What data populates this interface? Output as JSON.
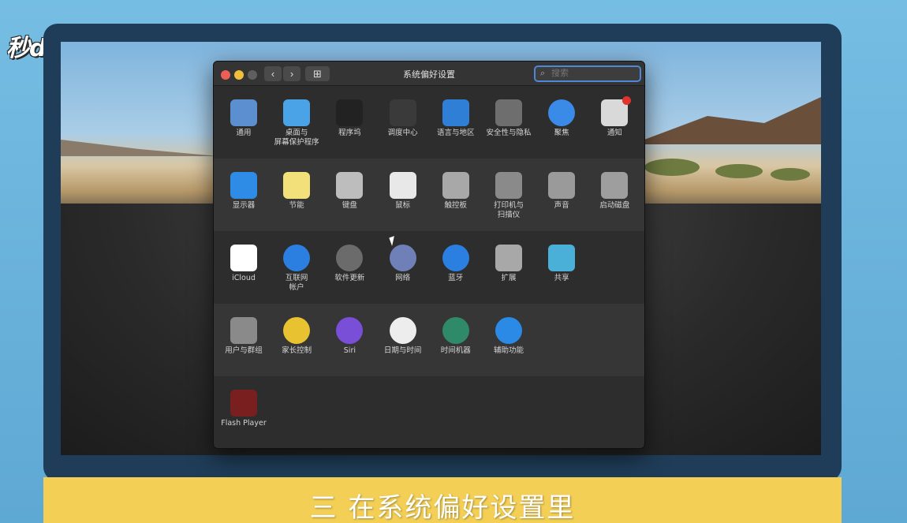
{
  "overlay": {
    "logo": "秒dong视频",
    "caption": "三 在系统偏好设置里"
  },
  "window": {
    "title": "系统偏好设置",
    "search_placeholder": "搜索",
    "nav_back": "‹",
    "nav_forward": "›",
    "grid_icon": "⊞"
  },
  "rows": [
    [
      {
        "label": "通用",
        "icon": "general-icon",
        "color": "#5b8fcf"
      },
      {
        "label": "桌面与\n屏幕保护程序",
        "icon": "desktop-screensaver-icon",
        "color": "#4aa3e6"
      },
      {
        "label": "程序坞",
        "icon": "dock-icon",
        "color": "#222222"
      },
      {
        "label": "调度中心",
        "icon": "mission-control-icon",
        "color": "#3a3a3a"
      },
      {
        "label": "语言与地区",
        "icon": "language-region-icon",
        "color": "#2f7fd6"
      },
      {
        "label": "安全性与隐私",
        "icon": "security-privacy-icon",
        "color": "#6e6e6e"
      },
      {
        "label": "聚焦",
        "icon": "spotlight-icon",
        "color": "#3a8be8"
      },
      {
        "label": "通知",
        "icon": "notifications-icon",
        "color": "#d9d9d9"
      }
    ],
    [
      {
        "label": "显示器",
        "icon": "displays-icon",
        "color": "#2e8be6"
      },
      {
        "label": "节能",
        "icon": "energy-saver-icon",
        "color": "#f2e07a"
      },
      {
        "label": "键盘",
        "icon": "keyboard-icon",
        "color": "#bdbdbd"
      },
      {
        "label": "鼠标",
        "icon": "mouse-icon",
        "color": "#e8e8e8"
      },
      {
        "label": "触控板",
        "icon": "trackpad-icon",
        "color": "#a8a8a8"
      },
      {
        "label": "打印机与\n扫描仪",
        "icon": "printer-icon",
        "color": "#8a8a8a"
      },
      {
        "label": "声音",
        "icon": "sound-icon",
        "color": "#9a9a9a"
      },
      {
        "label": "启动磁盘",
        "icon": "startup-disk-icon",
        "color": "#9e9e9e"
      }
    ],
    [
      {
        "label": "iCloud",
        "icon": "icloud-icon",
        "color": "#ffffff"
      },
      {
        "label": "互联网\n帐户",
        "icon": "internet-accounts-icon",
        "color": "#2a7fe0"
      },
      {
        "label": "软件更新",
        "icon": "software-update-icon",
        "color": "#6b6b6b"
      },
      {
        "label": "网络",
        "icon": "network-icon",
        "color": "#6f7fb8"
      },
      {
        "label": "蓝牙",
        "icon": "bluetooth-icon",
        "color": "#2a7fe0"
      },
      {
        "label": "扩展",
        "icon": "extensions-icon",
        "color": "#a8a8a8"
      },
      {
        "label": "共享",
        "icon": "sharing-icon",
        "color": "#4ab0d8"
      }
    ],
    [
      {
        "label": "用户与群组",
        "icon": "users-groups-icon",
        "color": "#8a8a8a"
      },
      {
        "label": "家长控制",
        "icon": "parental-controls-icon",
        "color": "#e8c230"
      },
      {
        "label": "Siri",
        "icon": "siri-icon",
        "color": "#7a4fd8"
      },
      {
        "label": "日期与时间",
        "icon": "date-time-icon",
        "color": "#ededed"
      },
      {
        "label": "时间机器",
        "icon": "time-machine-icon",
        "color": "#2f8a6a"
      },
      {
        "label": "辅助功能",
        "icon": "accessibility-icon",
        "color": "#2a8ae6"
      }
    ],
    [
      {
        "label": "Flash Player",
        "icon": "flash-player-icon",
        "color": "#7a1f1f"
      }
    ]
  ]
}
